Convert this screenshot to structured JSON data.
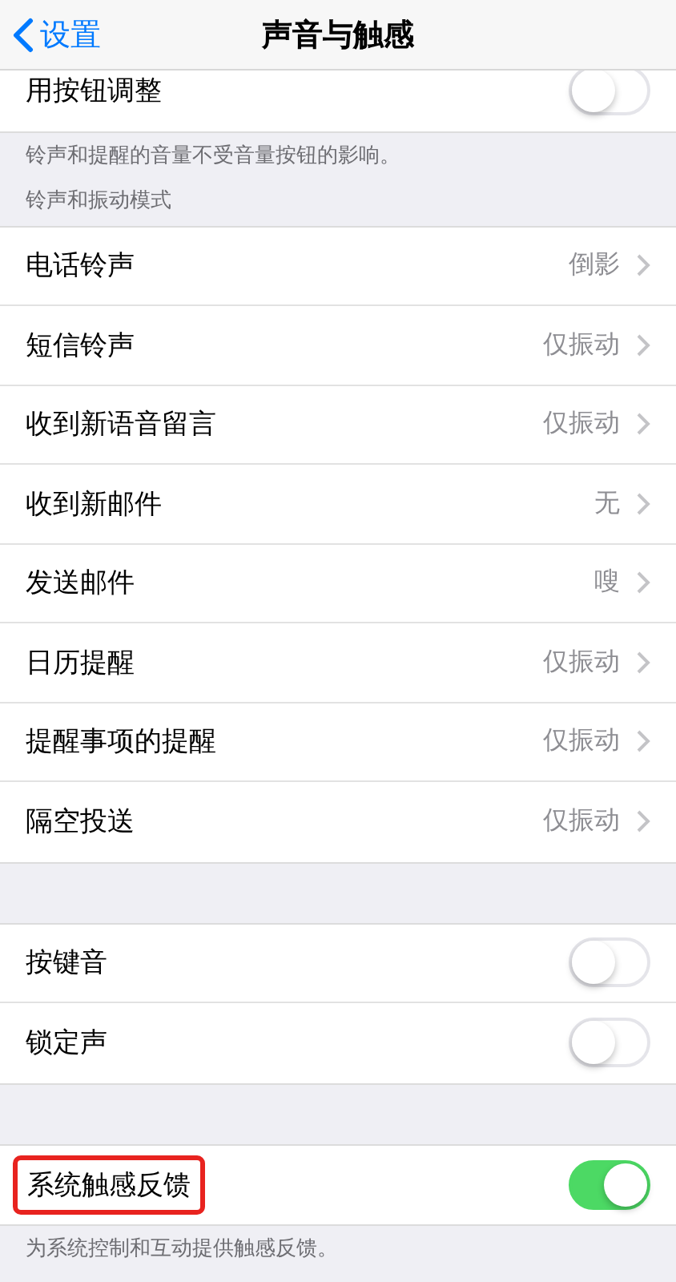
{
  "nav": {
    "back": "设置",
    "title": "声音与触感"
  },
  "sections": [
    {
      "rows": [
        {
          "kind": "toggle",
          "label": "用按钮调整",
          "on": false
        }
      ],
      "footer": "铃声和提醒的音量不受音量按钮的影响。"
    },
    {
      "header": "铃声和振动模式",
      "rows": [
        {
          "kind": "link",
          "label": "电话铃声",
          "value": "倒影"
        },
        {
          "kind": "link",
          "label": "短信铃声",
          "value": "仅振动"
        },
        {
          "kind": "link",
          "label": "收到新语音留言",
          "value": "仅振动"
        },
        {
          "kind": "link",
          "label": "收到新邮件",
          "value": "无"
        },
        {
          "kind": "link",
          "label": "发送邮件",
          "value": "嗖"
        },
        {
          "kind": "link",
          "label": "日历提醒",
          "value": "仅振动"
        },
        {
          "kind": "link",
          "label": "提醒事项的提醒",
          "value": "仅振动"
        },
        {
          "kind": "link",
          "label": "隔空投送",
          "value": "仅振动"
        }
      ]
    },
    {
      "rows": [
        {
          "kind": "toggle",
          "label": "按键音",
          "on": false
        },
        {
          "kind": "toggle",
          "label": "锁定声",
          "on": false
        }
      ]
    },
    {
      "rows": [
        {
          "kind": "toggle",
          "label": "系统触感反馈",
          "on": true,
          "highlighted": true
        }
      ],
      "footer": "为系统控制和互动提供触感反馈。"
    }
  ]
}
